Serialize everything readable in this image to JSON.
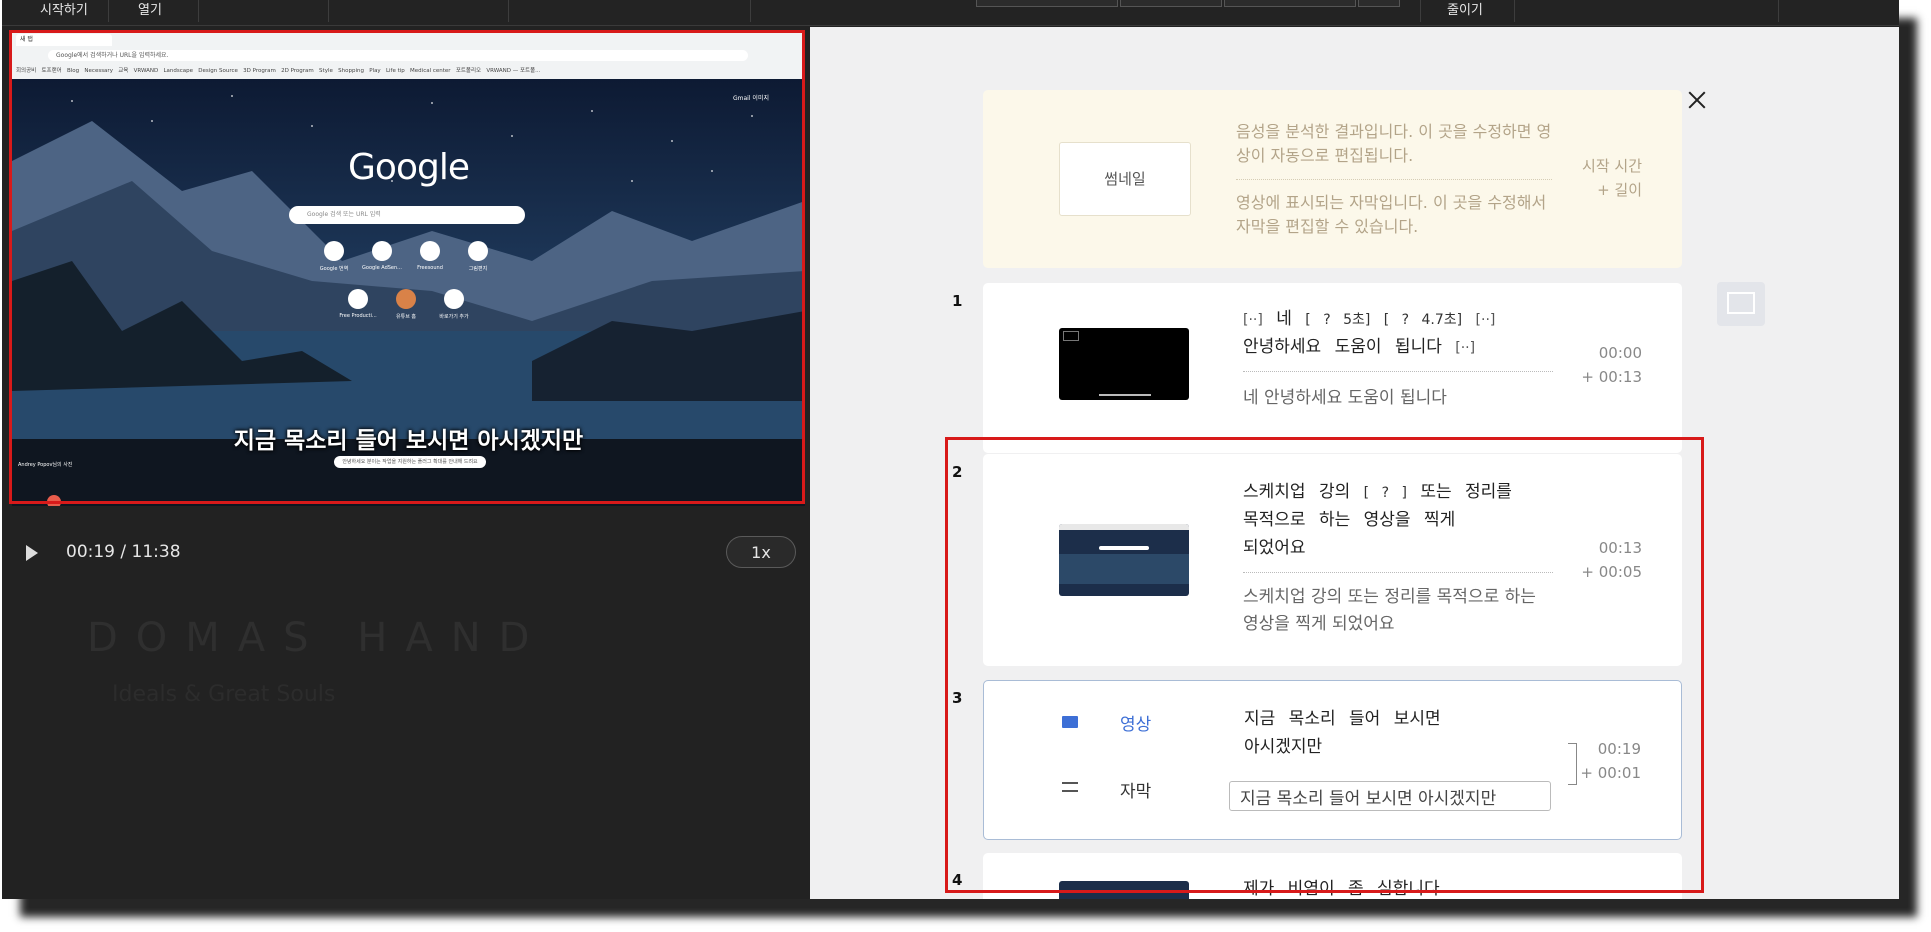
{
  "menubar": {
    "start_label": "시작하기",
    "open_label": "열기",
    "zoom_out_label": "줄이기"
  },
  "player": {
    "browser_tab_title": "새 탭",
    "browser_url_placeholder": "Google에서 검색하거나 URL을 입력하세요.",
    "bookmarks": [
      "회의공비",
      "토프랜어",
      "Blog",
      "Necessary",
      "교육",
      "VRWAND",
      "Landscape",
      "Design Source",
      "3D Program",
      "2D Program",
      "Style",
      "Shopping",
      "Play",
      "Life tip",
      "Medical center",
      "포트폴리오",
      "VRWAND — 포트폴..."
    ],
    "gmail_links": "Gmail   이미지",
    "google_logo": "Google",
    "google_search_placeholder": "Google 검색 또는 URL 입력",
    "shortcuts": [
      "Google 번역",
      "Google AdSen...",
      "Freesound",
      "그림편지",
      "Free Producti...",
      "유튜브 홈",
      "바로가기 추가"
    ],
    "subtitle_overlay": "지금 목소리 들어 보시면 아시겠지만",
    "photo_credit": "Andrey Popov님의 사진",
    "info_pill": "안녕하세요 분이는 작업을 지원하는 플러그 확대를 안내해 드려요",
    "progress": 0.028,
    "time_display": "00:19 / 11:38",
    "speed_label": "1x"
  },
  "watermark": {
    "line1": "DOMAS HAND",
    "line2": "Ideals & Great Souls"
  },
  "legend": {
    "thumbnail_label": "썸네일",
    "voice_text": "음성을 분석한 결과입니다. 이 곳을 수정하면 영상이 자동으로 편집됩니다.",
    "subtitle_text": "영상에 표시되는 자막입니다. 이 곳을 수정해서 자막을 편집할 수 있습니다.",
    "start_time_label": "시작 시간",
    "length_label": "+ 길이"
  },
  "segments": [
    {
      "number": "1",
      "tokens": [
        "[··]",
        "네",
        "[ ? 5초]",
        "[ ? 4.7초]",
        "[··]"
      ],
      "line2": "안녕하세요 도움이 됩니다",
      "line2_mark": "[··]",
      "subtitle": "네 안녕하세요 도움이 됩니다",
      "start": "00:00",
      "length": "+ 00:13"
    },
    {
      "number": "2",
      "line1_a": "스케치업 강의",
      "line1_mark": "[ ? ]",
      "line1_b": "또는 정리를",
      "line2": "목적으로 하는 영상을 찍게",
      "line3": "되었어요",
      "subtitle": "스케치업 강의 또는 정리를 목적으로 하는 영상을 찍게 되었어요",
      "start": "00:13",
      "length": "+ 00:05"
    },
    {
      "number": "3",
      "video_label": "영상",
      "subtitle_label": "자막",
      "line1": "지금 목소리 들어 보시면",
      "line2": "아시겠지만",
      "subtitle_input_value": "지금 목소리 들어 보시면 아시겠지만",
      "start": "00:19",
      "length": "+ 00:01"
    },
    {
      "number": "4",
      "line1": "제가 비염이 좀 심합니다"
    }
  ],
  "colors": {
    "highlight_red": "#d81a1a",
    "accent_blue": "#3d6fd6",
    "legend_bg": "#fcf8ea",
    "seek_red": "#e0443c"
  }
}
